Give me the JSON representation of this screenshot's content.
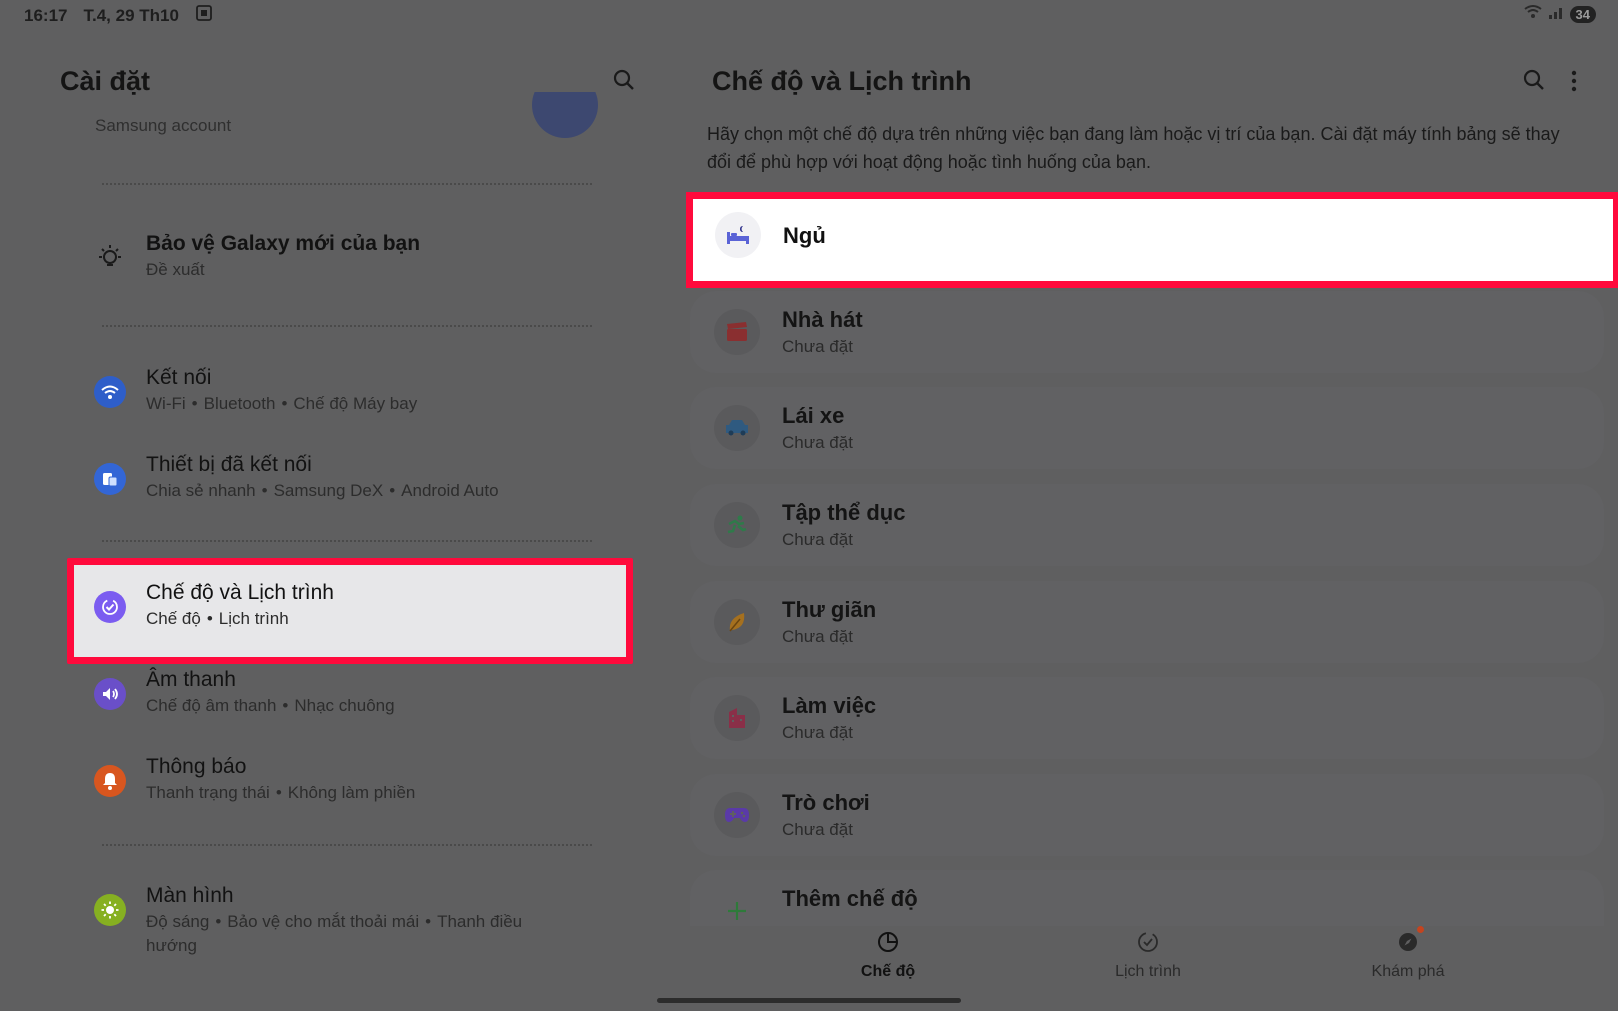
{
  "status_bar": {
    "time": "16:17",
    "date": "T.4, 29 Th10",
    "battery": "34"
  },
  "left_pane": {
    "title": "Cài đặt",
    "account_sub": "Samsung account",
    "items": [
      {
        "title": "Bảo vệ Galaxy mới của bạn",
        "sub": [
          "Đề xuất"
        ]
      },
      {
        "title": "Kết nối",
        "sub": [
          "Wi-Fi",
          "Bluetooth",
          "Chế độ Máy bay"
        ]
      },
      {
        "title": "Thiết bị đã kết nối",
        "sub": [
          "Chia sẻ nhanh",
          "Samsung DeX",
          "Android Auto"
        ]
      },
      {
        "title": "Chế độ và Lịch trình",
        "sub": [
          "Chế độ",
          "Lịch trình"
        ]
      },
      {
        "title": "Âm thanh",
        "sub": [
          "Chế độ âm thanh",
          "Nhạc chuông"
        ]
      },
      {
        "title": "Thông báo",
        "sub": [
          "Thanh trạng thái",
          "Không làm phiền"
        ]
      },
      {
        "title": "Màn hình",
        "sub": [
          "Độ sáng",
          "Bảo vệ cho mắt thoải mái",
          "Thanh điều"
        ],
        "sub2": "hướng"
      }
    ],
    "bullet": "•"
  },
  "right_pane": {
    "title": "Chế độ và Lịch trình",
    "description": "Hãy chọn một chế độ dựa trên những việc bạn đang làm hoặc vị trí của bạn. Cài đặt máy tính bảng sẽ thay đổi để phù hợp với hoạt động hoặc tình huống của bạn.",
    "modes": [
      {
        "title": "Ngủ",
        "sub": ""
      },
      {
        "title": "Nhà hát",
        "sub": "Chưa đặt"
      },
      {
        "title": "Lái xe",
        "sub": "Chưa đặt"
      },
      {
        "title": "Tập thể dục",
        "sub": "Chưa đặt"
      },
      {
        "title": "Thư giãn",
        "sub": "Chưa đặt"
      },
      {
        "title": "Làm việc",
        "sub": "Chưa đặt"
      },
      {
        "title": "Trò chơi",
        "sub": "Chưa đặt"
      }
    ],
    "add_mode": "Thêm chế độ"
  },
  "bottom_nav": [
    {
      "label": "Chế độ",
      "icon": "modes-icon"
    },
    {
      "label": "Lịch trình",
      "icon": "routines-icon"
    },
    {
      "label": "Khám phá",
      "icon": "discover-icon"
    }
  ],
  "colors": {
    "highlight": "#ff0a3c",
    "wifi": "#2e5ec9",
    "devices": "#3366d6",
    "modes": "#7b5cf0",
    "sound": "#6a4fc9",
    "notify": "#d8561f",
    "display": "#86b021"
  }
}
